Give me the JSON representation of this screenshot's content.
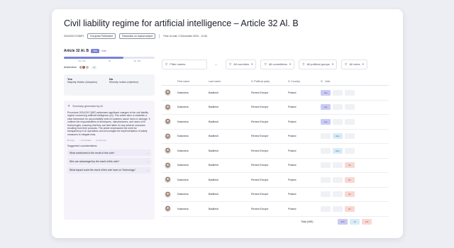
{
  "header": {
    "title": "Civil liability regime for artificial intelligence – Article 32 Al. B",
    "ref": "2024/2017/196P1",
    "chip1": "European Parliament",
    "chip2": "Resolution on topical subject",
    "time": "Time of vote: 2 December 2024 - 11:54"
  },
  "vote_summary": {
    "article": "Article 32 Al. B",
    "toggle_yes": "Yes",
    "toggle_no": "Vote",
    "yes_count_label": "Yes: 270",
    "mid_label": "19",
    "no_count_label": "No: 133",
    "yes_fraction": 0.66,
    "abstention_label": "Abstention",
    "abstention_more": "+8",
    "yes_head": "Yes",
    "yes_text": "Majority Motion (Adoption)",
    "no_head": "No",
    "no_text": "Minority motion (rejection)"
  },
  "ai_summary": {
    "heading": "Summary generated by AI",
    "text": "Procedure 2024/2017(INP) addresses significant changes to the civil liability regime concerning artificial intelligence (AI). This article aims to establish a clear framework for accountability when AI systems cause harm or damage. It outlines the responsibilities of developers, manufacturers, and users of AI technologies, ensuring that they are held liable for any adverse outcomes resulting from their products. The article emphasizes the need for transparency in AI operations and encourages the implementation of safety measures to mitigate risks.",
    "actions": [
      "Copy",
      "Committee",
      "Sources"
    ],
    "suggestions_heading": "Suggested considerations:",
    "suggestions": [
      "What contributed to the result of this vote?",
      "Who are advantaged by the result of this vote?",
      "What impact could the result of this vote have on Technology?"
    ]
  },
  "filters": {
    "search_placeholder": "Filter names",
    "countries": "All countries",
    "committees": "All committees",
    "groups": "All political groups",
    "votes": "All votes"
  },
  "table": {
    "headers": [
      "First name",
      "Last name",
      "Political party",
      "Country",
      "Vote"
    ],
    "rows": [
      {
        "first": "Katarzina",
        "last": "Badileoii",
        "party": "Renew Europe",
        "country": "Poland",
        "vote": "Yes"
      },
      {
        "first": "Katarzina",
        "last": "Badileoii",
        "party": "Renew Europe",
        "country": "Poland",
        "vote": "Yes"
      },
      {
        "first": "Katarzina",
        "last": "Badileoii",
        "party": "Renew Europe",
        "country": "Poland",
        "vote": "Yes"
      },
      {
        "first": "Katarzina",
        "last": "Badileoii",
        "party": "Renew Europe",
        "country": "Poland",
        "vote": "Abst."
      },
      {
        "first": "Katarzina",
        "last": "Badileoii",
        "party": "Renew Europe",
        "country": "Poland",
        "vote": "Abst."
      },
      {
        "first": "Katarzina",
        "last": "Badileoii",
        "party": "Renew Europe",
        "country": "Poland",
        "vote": "No"
      },
      {
        "first": "Katarzina",
        "last": "Badileoii",
        "party": "Renew Europe",
        "country": "Poland",
        "vote": "No"
      },
      {
        "first": "Katarzina",
        "last": "Badileoii",
        "party": "Renew Europe",
        "country": "Poland",
        "vote": "No"
      },
      {
        "first": "Katarzina",
        "last": "Badileoii",
        "party": "Renew Europe",
        "country": "Poland",
        "vote": "No"
      }
    ],
    "total_label": "Total (405)",
    "total_yes": "270",
    "total_abst": "19",
    "total_no": "133"
  },
  "colors": {
    "accent": "#7a82d9",
    "yes": "#c9cbf2",
    "abstain": "#d8ecf7",
    "no": "#f8d8d4"
  }
}
